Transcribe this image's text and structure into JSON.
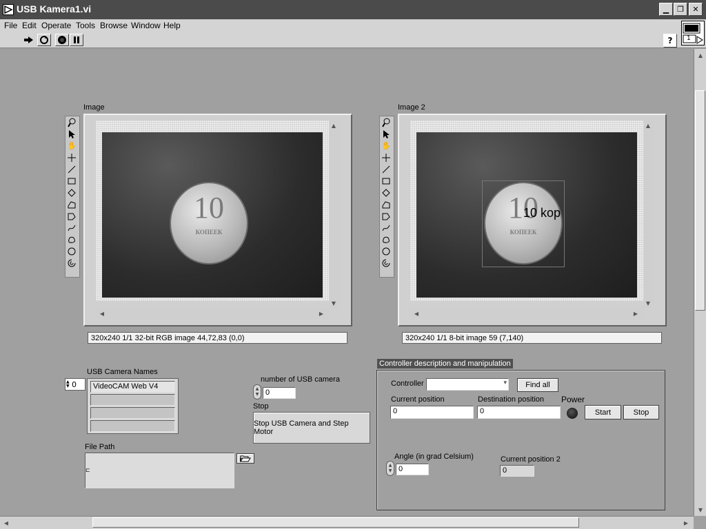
{
  "window": {
    "title": "USB Kamera1.vi"
  },
  "menubar": {
    "items": [
      "File",
      "Edit",
      "Operate",
      "Tools",
      "Browse",
      "Window",
      "Help"
    ]
  },
  "toolbar": {
    "buttons": [
      "run-arrow-icon",
      "run-continuously-icon",
      "abort-icon",
      "pause-icon"
    ],
    "help": "?"
  },
  "vi_icon": {
    "connector_number": "1"
  },
  "image1": {
    "label": "Image",
    "coin_text": "10",
    "coin_subtext": "КОПЕЕК",
    "status": "320x240 1/1 32-bit RGB image 44,72,83    (0,0)"
  },
  "image2": {
    "label": "Image 2",
    "coin_text": "10",
    "coin_subtext": "КОПЕЕК",
    "overlay_text": "10 kop",
    "status": "320x240 1/1 8-bit image 59    (7,140)"
  },
  "tools": [
    "zoom-icon",
    "pointer-icon",
    "hand-icon",
    "crosshair-icon",
    "line-icon",
    "rectangle-icon",
    "rotated-rect-icon",
    "polygon-icon",
    "freehand-polygon-icon",
    "freehand-line-icon",
    "freehand-region-icon",
    "oval-icon",
    "annulus-icon"
  ],
  "usb_camera": {
    "label": "USB Camera Names",
    "index": "0",
    "names": [
      "VideoCAM Web V4",
      "",
      "",
      ""
    ]
  },
  "number_camera": {
    "label": "number of USB camera",
    "value": "0"
  },
  "stop": {
    "label": "Stop",
    "button": "Stop USB Camera and Step Motor"
  },
  "file_path": {
    "label": "File Path",
    "value": ""
  },
  "controller": {
    "section_title": "Controller description and manipulation",
    "controller_label": "Controller",
    "controller_value": "",
    "find_all": "Find all",
    "current_position_label": "Current position",
    "current_position_value": "0",
    "destination_position_label": "Destination position",
    "destination_position_value": "0",
    "power_label": "Power",
    "start": "Start",
    "stop": "Stop",
    "angle_label": "Angle (in grad Celsium)",
    "angle_value": "0",
    "current_position2_label": "Current position 2",
    "current_position2_value": "0"
  },
  "colors": {
    "titlebar": "#4b4b4b",
    "panel": "#a0a0a0",
    "menubar": "#d4d4d4"
  }
}
